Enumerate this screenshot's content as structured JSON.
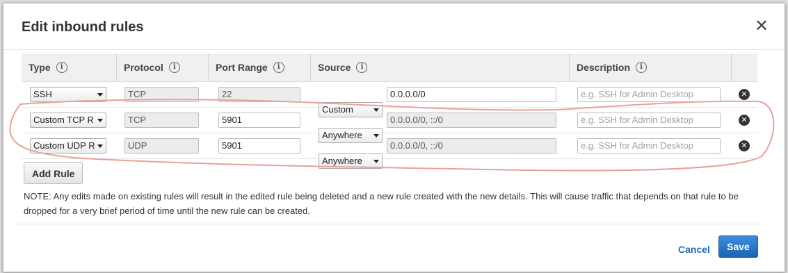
{
  "dialog": {
    "title": "Edit inbound rules",
    "close_label": "✕"
  },
  "table": {
    "headers": [
      {
        "label": "Type",
        "info": "i"
      },
      {
        "label": "Protocol",
        "info": "i"
      },
      {
        "label": "Port Range",
        "info": "i"
      },
      {
        "label": "Source",
        "info": "i"
      },
      {
        "label": "Description",
        "info": "i"
      }
    ],
    "rows": [
      {
        "type": "SSH",
        "protocol": "TCP",
        "port": "22",
        "source_type": "Custom",
        "source": "0.0.0.0/0",
        "description_placeholder": "e.g. SSH for Admin Desktop"
      },
      {
        "type": "Custom TCP R",
        "protocol": "TCP",
        "port": "5901",
        "source_type": "Anywhere",
        "source": "0.0.0.0/0, ::/0",
        "description_placeholder": "e.g. SSH for Admin Desktop"
      },
      {
        "type": "Custom UDP R",
        "protocol": "UDP",
        "port": "5901",
        "source_type": "Anywhere",
        "source": "0.0.0.0/0, ::/0",
        "description_placeholder": "e.g. SSH for Admin Desktop"
      }
    ]
  },
  "add_rule_label": "Add Rule",
  "note": "NOTE: Any edits made on existing rules will result in the edited rule being deleted and a new rule created with the new details. This will cause traffic that depends on that rule to be dropped for a very brief period of time until the new rule can be created.",
  "footer": {
    "cancel_label": "Cancel",
    "save_label": "Save"
  },
  "colors": {
    "primary": "#1d65b5",
    "link": "#1f6fbf",
    "annotation": "#e8a09a"
  },
  "icons": {
    "close": "close-icon",
    "info": "info-icon",
    "remove": "remove-row-icon",
    "dropdown": "caret-down-icon"
  }
}
